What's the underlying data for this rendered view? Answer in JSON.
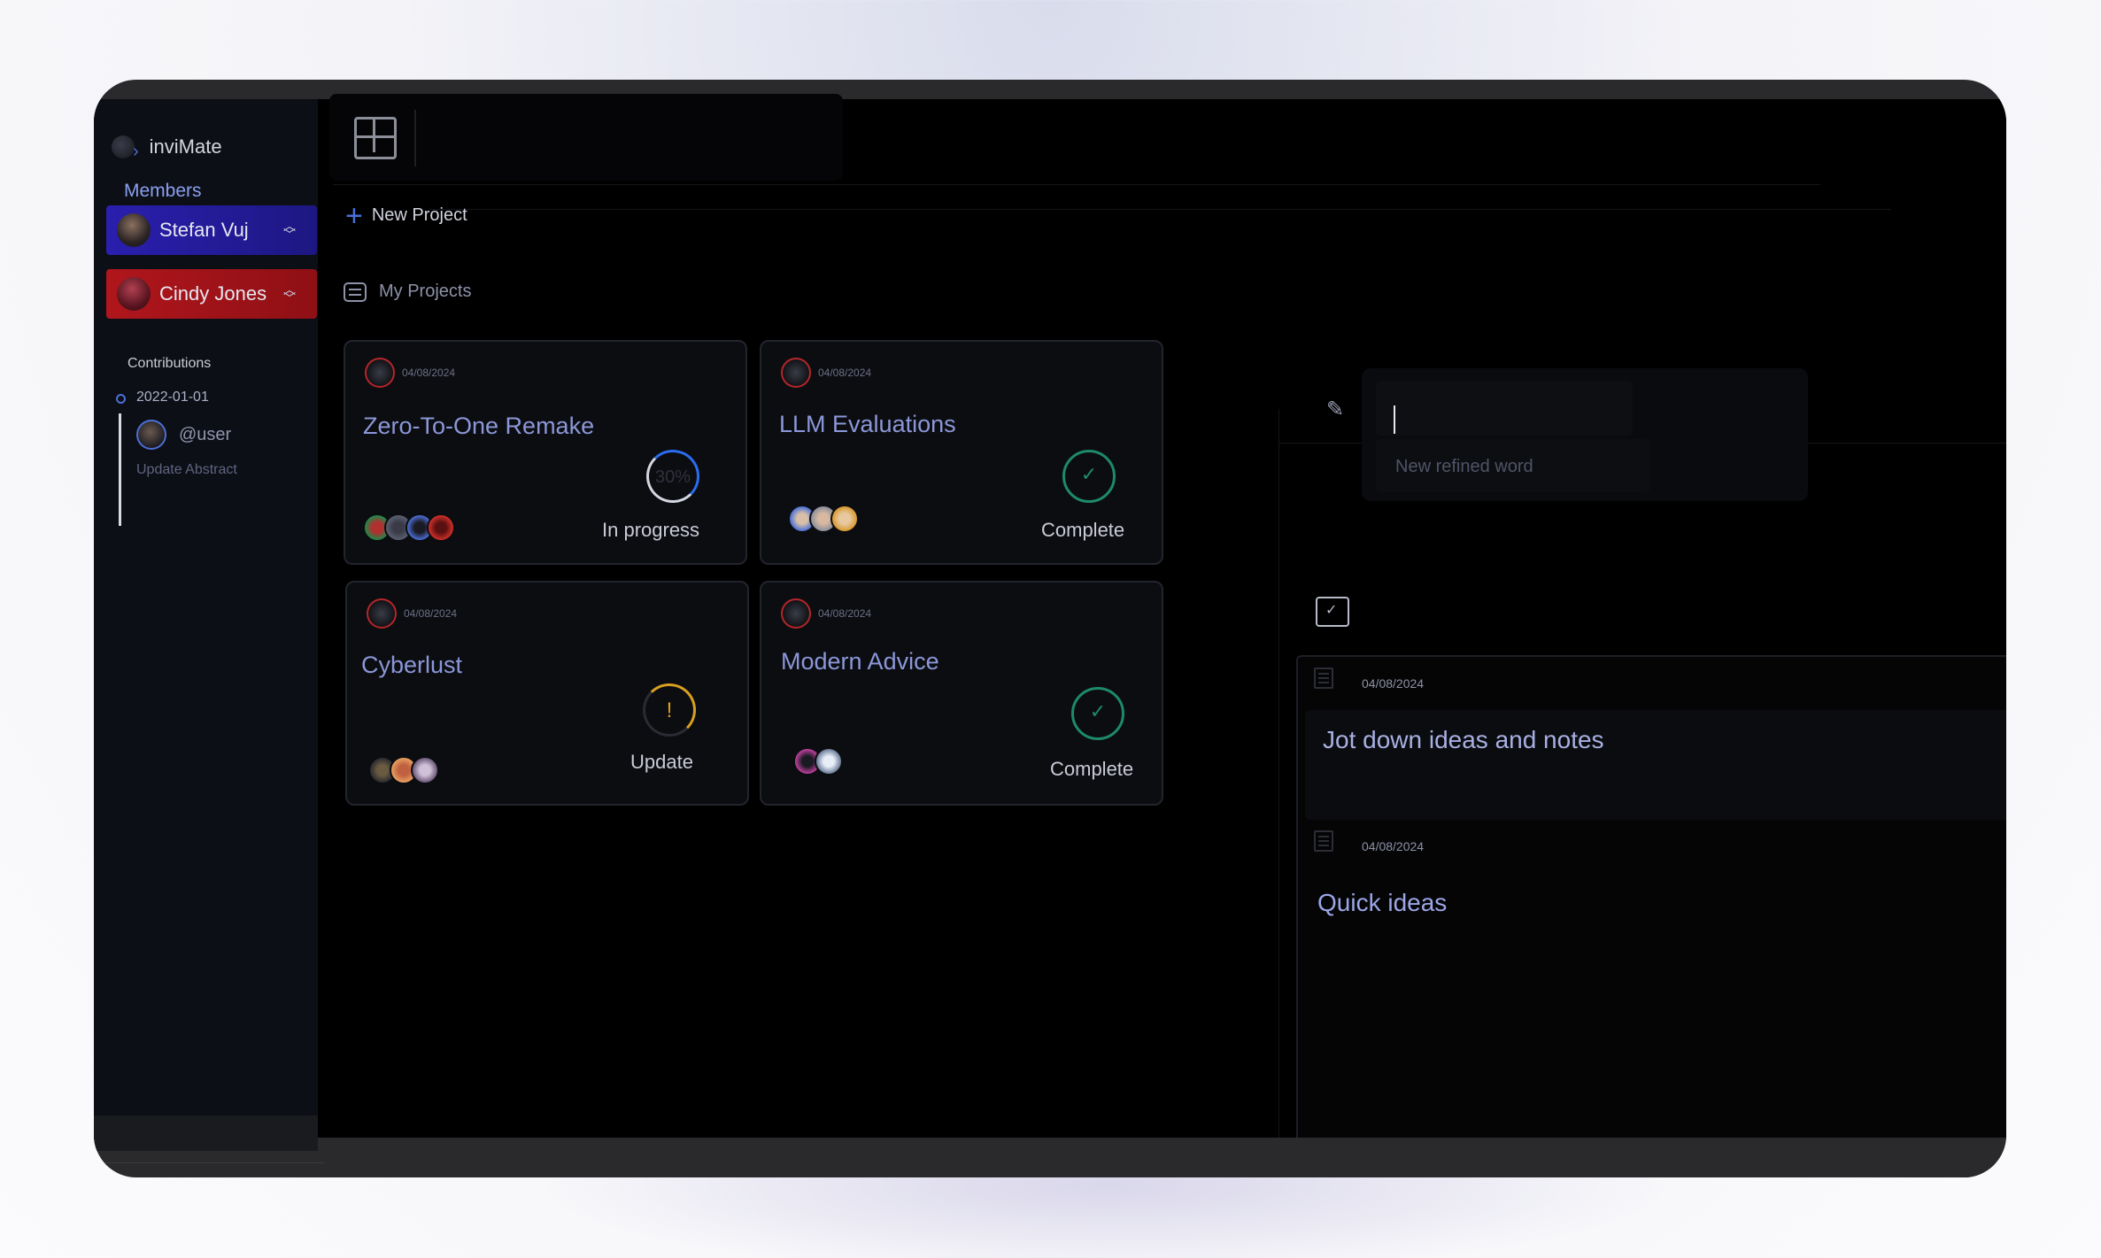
{
  "app": {
    "name": "inviMate"
  },
  "sidebar": {
    "members_label": "Members",
    "members": [
      {
        "name": "Stefan Vuj",
        "color": "#2a1fae"
      },
      {
        "name": "Cindy Jones",
        "color": "#b0161c"
      }
    ],
    "contributions_label": "Contributions",
    "timeline": [
      {
        "date": "2022-01-01",
        "user": "@user",
        "action": "Update Abstract"
      }
    ]
  },
  "toolbar": {
    "new_project_label": "New Project"
  },
  "projects_label": "My Projects",
  "projects": [
    {
      "date": "04/08/2024",
      "title": "Zero-To-One Remake",
      "status": "In progress",
      "progress_label": "30%",
      "progress": 0.3,
      "indicator": "progress"
    },
    {
      "date": "04/08/2024",
      "title": "LLM Evaluations",
      "status": "Complete",
      "indicator": "check"
    },
    {
      "date": "04/08/2024",
      "title": "Cyberlust",
      "status": "Update",
      "indicator": "warning"
    },
    {
      "date": "04/08/2024",
      "title": "Modern Advice",
      "status": "Complete",
      "indicator": "check"
    }
  ],
  "word_panel": {
    "input_value": "",
    "new_word_placeholder": "New refined word"
  },
  "notes": [
    {
      "date": "04/08/2024",
      "title": "Jot down ideas and notes"
    },
    {
      "date": "04/08/2024",
      "title": "Quick ideas"
    }
  ],
  "colors": {
    "accent_blue": "#2b6cf0",
    "complete_green": "#1d8a6a",
    "warning_amber": "#d8a020",
    "danger_red": "#b0161c"
  }
}
